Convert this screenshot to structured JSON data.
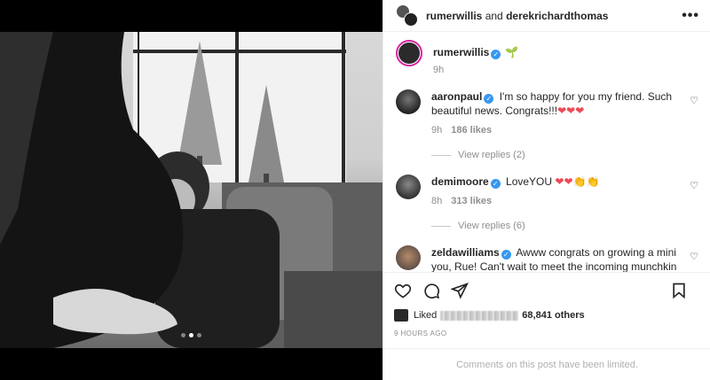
{
  "header": {
    "user1": "rumerwillis",
    "conjunction": "and",
    "user2": "derekrichardthomas",
    "more_icon": "more-horizontal-icon"
  },
  "caption": {
    "username": "rumerwillis",
    "emoji": "🌱",
    "time": "9h"
  },
  "comments": [
    {
      "username": "aaronpaul",
      "text": "I'm so happy for you my friend. Such beautiful news. Congrats!!!",
      "emoji": "❤❤❤",
      "time": "9h",
      "likes": "186 likes",
      "replies": "View replies (2)"
    },
    {
      "username": "demimoore",
      "text": "LoveYOU",
      "emoji": "❤❤👏👏",
      "time": "8h",
      "likes": "313 likes",
      "replies": "View replies (6)"
    },
    {
      "username": "zeldawilliams",
      "text": "Awww congrats on growing a mini you, Rue! Can't wait to meet the incoming munchkin one day soon ♥"
    }
  ],
  "actions": {
    "liked_prefix": "Liked",
    "liked_suffix": "68,841 others",
    "timestamp": "9 HOURS AGO"
  },
  "footer": {
    "limited_text": "Comments on this post have been limited."
  },
  "carousel": {
    "count": 3,
    "active_index": 1
  }
}
